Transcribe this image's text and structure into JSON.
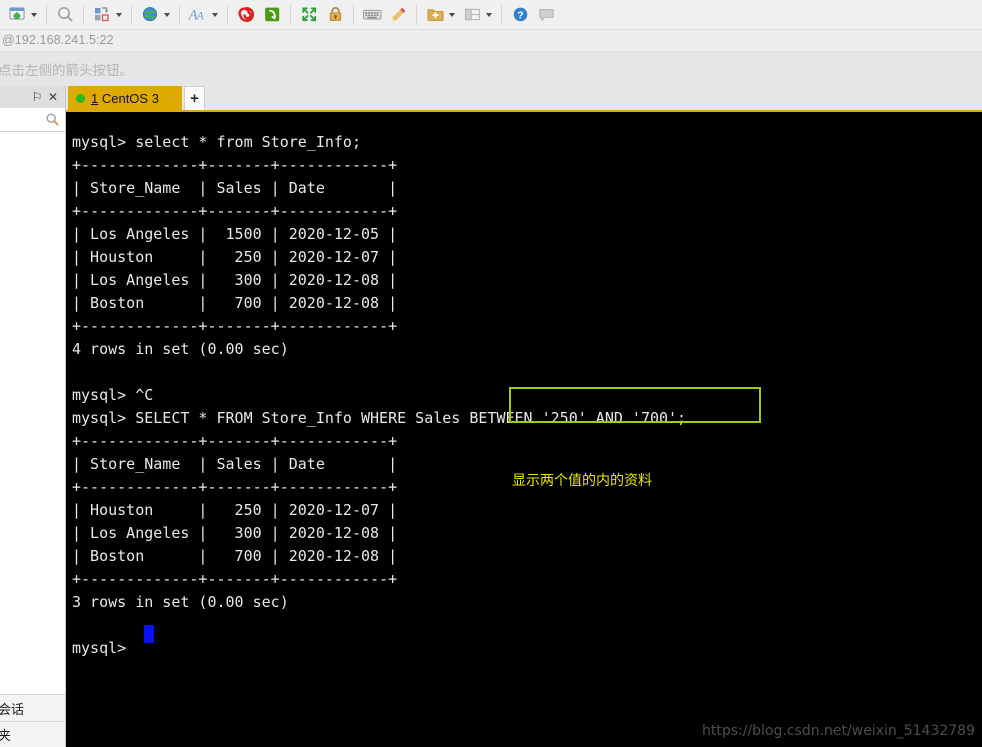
{
  "toolbar": {
    "buttons": [
      {
        "name": "session-manager-icon",
        "glyph": "session",
        "caret": true
      },
      {
        "name": "search-icon",
        "glyph": "magnifier",
        "caret": false
      },
      {
        "name": "transfer-icon",
        "glyph": "transfer",
        "caret": true
      },
      {
        "name": "globe-icon",
        "glyph": "globe",
        "caret": true
      },
      {
        "name": "font-icon",
        "glyph": "font-a",
        "caret": true
      },
      {
        "name": "spiral-icon",
        "glyph": "spiral",
        "caret": false
      },
      {
        "name": "sync-icon",
        "glyph": "sync-green",
        "caret": false
      },
      {
        "name": "fullscreen-icon",
        "glyph": "fullscreen",
        "caret": false
      },
      {
        "name": "lock-icon",
        "glyph": "lock",
        "caret": false
      },
      {
        "name": "keyboard-icon",
        "glyph": "keyboard",
        "caret": false
      },
      {
        "name": "highlighter-icon",
        "glyph": "pen",
        "caret": false
      },
      {
        "name": "new-folder-icon",
        "glyph": "folder-plus",
        "caret": true
      },
      {
        "name": "layout-icon",
        "glyph": "layout",
        "caret": true
      },
      {
        "name": "help-icon",
        "glyph": "help",
        "caret": false
      },
      {
        "name": "comment-icon",
        "glyph": "comment",
        "caret": false
      }
    ]
  },
  "address_bar": {
    "text": "@192.168.241.5:22"
  },
  "hint_bar": {
    "text": "点击左侧的箭头按钮。"
  },
  "sidebar": {
    "pin_label": "⚐",
    "close_label": "✕",
    "search_placeholder": "",
    "footer_items": [
      {
        "label": "会话"
      },
      {
        "label": "夹"
      }
    ]
  },
  "tabbar": {
    "active_tab": {
      "index_label": "1",
      "name_label": " CentOS 3",
      "close_label": "×",
      "status": "connected"
    },
    "new_tab_label": "+"
  },
  "terminal": {
    "lines": [
      "mysql> select * from Store_Info;",
      "+-------------+-------+------------+",
      "| Store_Name  | Sales | Date       |",
      "+-------------+-------+------------+",
      "| Los Angeles |  1500 | 2020-12-05 |",
      "| Houston     |   250 | 2020-12-07 |",
      "| Los Angeles |   300 | 2020-12-08 |",
      "| Boston      |   700 | 2020-12-08 |",
      "+-------------+-------+------------+",
      "4 rows in set (0.00 sec)",
      "",
      "mysql> ^C",
      "mysql> SELECT * FROM Store_Info WHERE Sales BETWEEN '250' AND '700';",
      "+-------------+-------+------------+",
      "| Store_Name  | Sales | Date       |",
      "+-------------+-------+------------+",
      "| Houston     |   250 | 2020-12-07 |",
      "| Los Angeles |   300 | 2020-12-08 |",
      "| Boston      |   700 | 2020-12-08 |",
      "+-------------+-------+------------+",
      "3 rows in set (0.00 sec)",
      "",
      "mysql> "
    ],
    "highlighted_fragment": "BETWEEN '250' AND '700';",
    "highlight_color": "#9ecc00",
    "annotation": "显示两个值的内的资料",
    "annotation_color": "#e8e800",
    "cursor_color": "#0a10f0",
    "background": "#000000",
    "foreground": "#e8e8e8"
  },
  "watermark": {
    "text": "https://blog.csdn.net/weixin_51432789"
  }
}
